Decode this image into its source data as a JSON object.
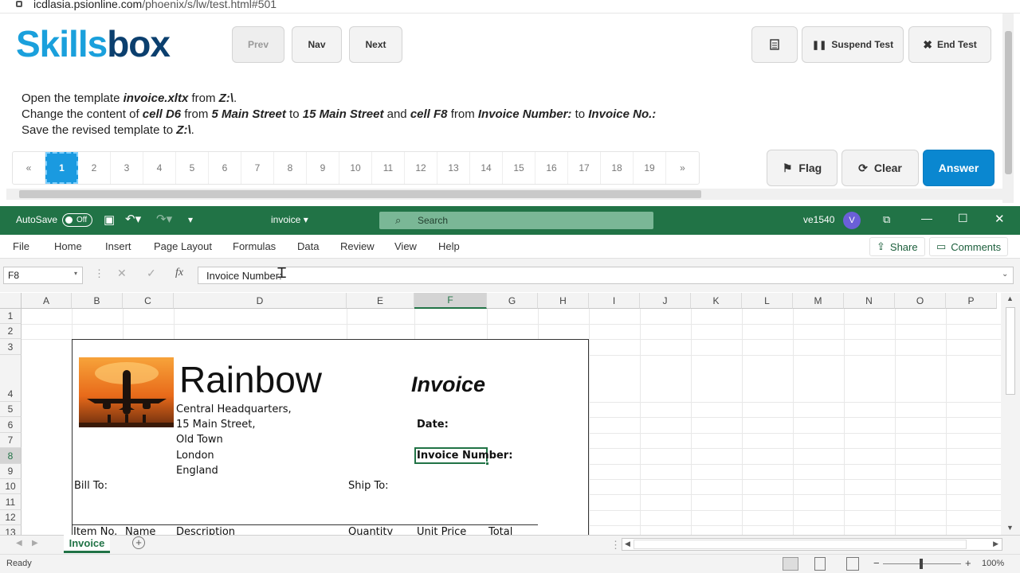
{
  "browser": {
    "url_host": "icdlasia.psionline.com",
    "url_path": "/phoenix/s/lw/test.html#501"
  },
  "skillsbox": {
    "logo_a": "Skills",
    "logo_b": "box",
    "nav": {
      "prev": "Prev",
      "nav": "Nav",
      "next": "Next"
    },
    "right_buttons": {
      "suspend": "Suspend Test",
      "end": "End Test"
    },
    "task": {
      "l1a": "Open the template ",
      "l1b": "invoice.xltx",
      "l1c": " from ",
      "l1d": "Z:\\",
      "l1e": ".",
      "l2a": "Change the content of ",
      "l2b": "cell D6",
      "l2c": " from ",
      "l2d": "5 Main Street",
      "l2e": " to ",
      "l2f": "15 Main Street",
      "l2g": " and ",
      "l2h": "cell F8",
      "l2i": " from ",
      "l2j": "Invoice Number:",
      "l2k": " to ",
      "l2l": "Invoice No.:",
      "l3a": "Save the revised template to ",
      "l3b": "Z:\\",
      "l3c": "."
    },
    "pager": [
      "«",
      "1",
      "2",
      "3",
      "4",
      "5",
      "6",
      "7",
      "8",
      "9",
      "10",
      "11",
      "12",
      "13",
      "14",
      "15",
      "16",
      "17",
      "18",
      "19",
      "»"
    ],
    "actions": {
      "flag": "Flag",
      "clear": "Clear",
      "answer": "Answer"
    }
  },
  "excel": {
    "autosave": "AutoSave",
    "autosave_state": "Off",
    "file_title": "invoice",
    "search_placeholder": "Search",
    "user": "ve1540",
    "user_initial": "V",
    "menu": [
      "File",
      "Home",
      "Insert",
      "Page Layout",
      "Formulas",
      "Data",
      "Review",
      "View",
      "Help"
    ],
    "share": "Share",
    "comments": "Comments",
    "name_box": "F8",
    "formula": "Invoice Number:",
    "columns": [
      "A",
      "B",
      "C",
      "D",
      "E",
      "F",
      "G",
      "H",
      "I",
      "J",
      "K",
      "L",
      "M",
      "N",
      "O",
      "P"
    ],
    "rows": [
      "1",
      "2",
      "3",
      "4",
      "5",
      "6",
      "7",
      "8",
      "9",
      "10",
      "11",
      "12",
      "13"
    ],
    "cells": {
      "company": "Rainbow",
      "invoice_title": "Invoice",
      "addr1": "Central Headquarters,",
      "addr2": "15 Main Street,",
      "addr3": "Old Town",
      "addr4": "London",
      "addr5": "England",
      "date": "Date:",
      "invoice_number": "Invoice Number:",
      "bill_to": "Bill To:",
      "ship_to": "Ship To:",
      "h_item": "Item No.",
      "h_name": "Name",
      "h_desc": "Description",
      "h_qty": "Quantity",
      "h_price": "Unit Price",
      "h_total": "Total"
    },
    "sheet_tab": "Invoice",
    "status": "Ready",
    "zoom": "100%"
  }
}
